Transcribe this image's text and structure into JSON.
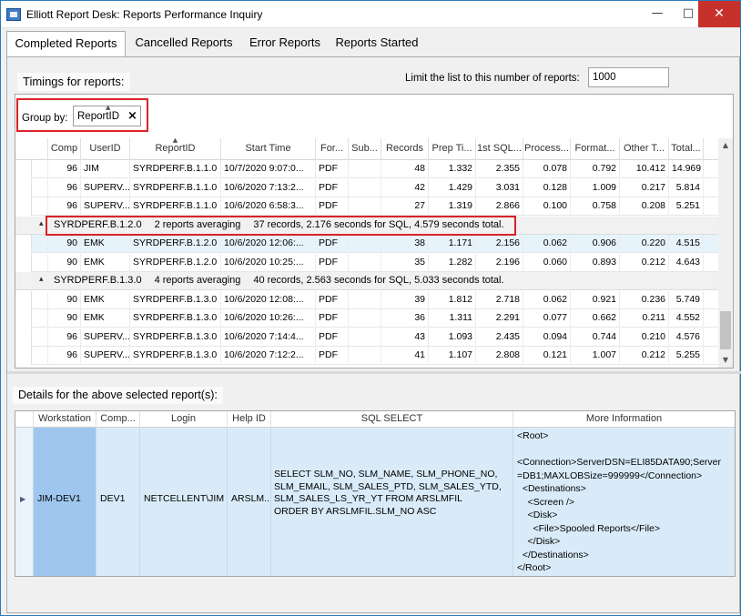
{
  "window": {
    "title": "Elliott Report Desk: Reports Performance Inquiry"
  },
  "tabs": [
    {
      "label": "Completed Reports",
      "active": true
    },
    {
      "label": "Cancelled Reports",
      "active": false
    },
    {
      "label": "Error Reports",
      "active": false
    },
    {
      "label": "Reports Started",
      "active": false
    }
  ],
  "timings": {
    "label": "Timings for reports:",
    "limit_label": "Limit the list to this number of reports:",
    "limit_value": "1000"
  },
  "group_by": {
    "label": "Group by:",
    "chip": "ReportID"
  },
  "grid": {
    "columns": [
      "Comp",
      "UserID",
      "ReportID",
      "Start Time",
      "For...",
      "Sub...",
      "Records",
      "Prep Ti...",
      "1st SQL...",
      "Process...",
      "Format...",
      "Other T...",
      "Total..."
    ],
    "rows": [
      {
        "type": "data",
        "cells": [
          "96",
          "JIM",
          "SYRDPERF.B.1.1.0",
          "10/7/2020  9:07:0...",
          "PDF",
          "",
          "48",
          "1.332",
          "2.355",
          "0.078",
          "0.792",
          "10.412",
          "14.969"
        ]
      },
      {
        "type": "data",
        "cells": [
          "96",
          "SUPERV...",
          "SYRDPERF.B.1.1.0",
          "10/6/2020  7:13:2...",
          "PDF",
          "",
          "42",
          "1.429",
          "3.031",
          "0.128",
          "1.009",
          "0.217",
          "5.814"
        ]
      },
      {
        "type": "data",
        "cells": [
          "96",
          "SUPERV...",
          "SYRDPERF.B.1.1.0",
          "10/6/2020  6:58:3...",
          "PDF",
          "",
          "27",
          "1.319",
          "2.866",
          "0.100",
          "0.758",
          "0.208",
          "5.251"
        ]
      },
      {
        "type": "group",
        "id": "SYRDPERF.B.1.2.0",
        "avg": "2 reports averaging",
        "stats": "37 records,  2.176 seconds for SQL,  4.579 seconds total."
      },
      {
        "type": "data",
        "selected": true,
        "cells": [
          "90",
          "EMK",
          "SYRDPERF.B.1.2.0",
          "10/6/2020  12:06:...",
          "PDF",
          "",
          "38",
          "1.171",
          "2.156",
          "0.062",
          "0.906",
          "0.220",
          "4.515"
        ]
      },
      {
        "type": "data",
        "cells": [
          "90",
          "EMK",
          "SYRDPERF.B.1.2.0",
          "10/6/2020  10:25:...",
          "PDF",
          "",
          "35",
          "1.282",
          "2.196",
          "0.060",
          "0.893",
          "0.212",
          "4.643"
        ]
      },
      {
        "type": "group",
        "id": "SYRDPERF.B.1.3.0",
        "avg": "4 reports averaging",
        "stats": "40 records,  2.563 seconds for SQL,  5.033 seconds total."
      },
      {
        "type": "data",
        "cells": [
          "90",
          "EMK",
          "SYRDPERF.B.1.3.0",
          "10/6/2020  12:08:...",
          "PDF",
          "",
          "39",
          "1.812",
          "2.718",
          "0.062",
          "0.921",
          "0.236",
          "5.749"
        ]
      },
      {
        "type": "data",
        "cells": [
          "90",
          "EMK",
          "SYRDPERF.B.1.3.0",
          "10/6/2020  10:26:...",
          "PDF",
          "",
          "36",
          "1.311",
          "2.291",
          "0.077",
          "0.662",
          "0.211",
          "4.552"
        ]
      },
      {
        "type": "data",
        "cells": [
          "96",
          "SUPERV...",
          "SYRDPERF.B.1.3.0",
          "10/6/2020  7:14:4...",
          "PDF",
          "",
          "43",
          "1.093",
          "2.435",
          "0.094",
          "0.744",
          "0.210",
          "4.576"
        ]
      },
      {
        "type": "data",
        "cells": [
          "96",
          "SUPERV...",
          "SYRDPERF.B.1.3.0",
          "10/6/2020  7:12:2...",
          "PDF",
          "",
          "41",
          "1.107",
          "2.808",
          "0.121",
          "1.007",
          "0.212",
          "5.255"
        ]
      }
    ]
  },
  "details": {
    "label": "Details for the above selected report(s):",
    "columns": [
      "Workstation",
      "Comp...",
      "Login",
      "Help ID",
      "SQL SELECT",
      "More Information"
    ],
    "row": {
      "workstation": "JIM-DEV1",
      "comp": "DEV1",
      "login": "NETCELLENT\\JIM",
      "help_id": "ARSLM...",
      "sql": "SELECT SLM_NO, SLM_NAME, SLM_PHONE_NO,\nSLM_EMAIL, SLM_SALES_PTD, SLM_SALES_YTD,\nSLM_SALES_LS_YR_YT FROM ARSLMFIL\nORDER BY ARSLMFIL.SLM_NO ASC",
      "more_info": "<Root>\n\n<Connection>ServerDSN=ELI85DATA90;Server\n=DB1;MAXLOBSize=999999</Connection>\n  <Destinations>\n    <Screen />\n    <Disk>\n      <File>Spooled Reports</File>\n    </Disk>\n  </Destinations>\n</Root>"
    }
  }
}
